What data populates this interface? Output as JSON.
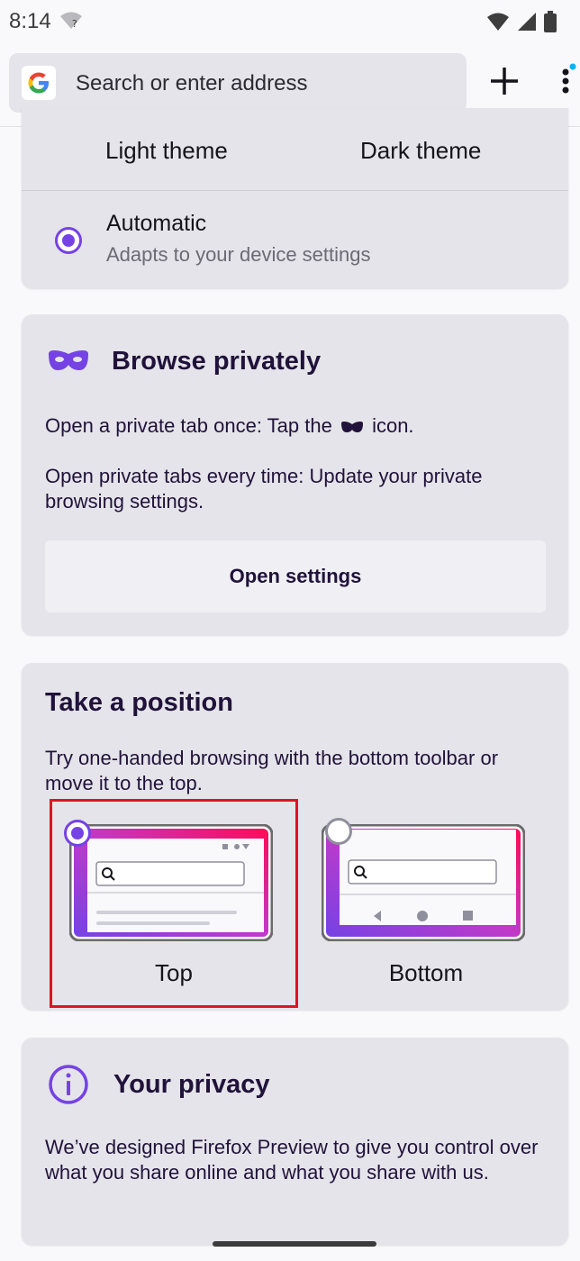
{
  "status": {
    "time": "8:14"
  },
  "toolbar": {
    "url_placeholder": "Search or enter address"
  },
  "theme": {
    "light_label": "Light theme",
    "dark_label": "Dark theme",
    "automatic_title": "Automatic",
    "automatic_subtitle": "Adapts to your device settings",
    "selected": "automatic"
  },
  "private": {
    "title": "Browse privately",
    "line1_before": "Open a private tab once: Tap the",
    "line1_after": "icon.",
    "line2": "Open private tabs every time: Update your private browsing settings.",
    "button": "Open settings"
  },
  "position": {
    "title": "Take a position",
    "description": "Try one-handed browsing with the bottom toolbar or move it to the top.",
    "options": [
      {
        "label": "Top",
        "selected": true
      },
      {
        "label": "Bottom",
        "selected": false
      }
    ]
  },
  "privacy": {
    "title": "Your privacy",
    "description": "We’ve designed Firefox Preview to give you control over what you share online and what you share with us."
  },
  "colors": {
    "accent": "#7542e5",
    "highlight": "#e0131f",
    "card": "#e5e4ea"
  }
}
